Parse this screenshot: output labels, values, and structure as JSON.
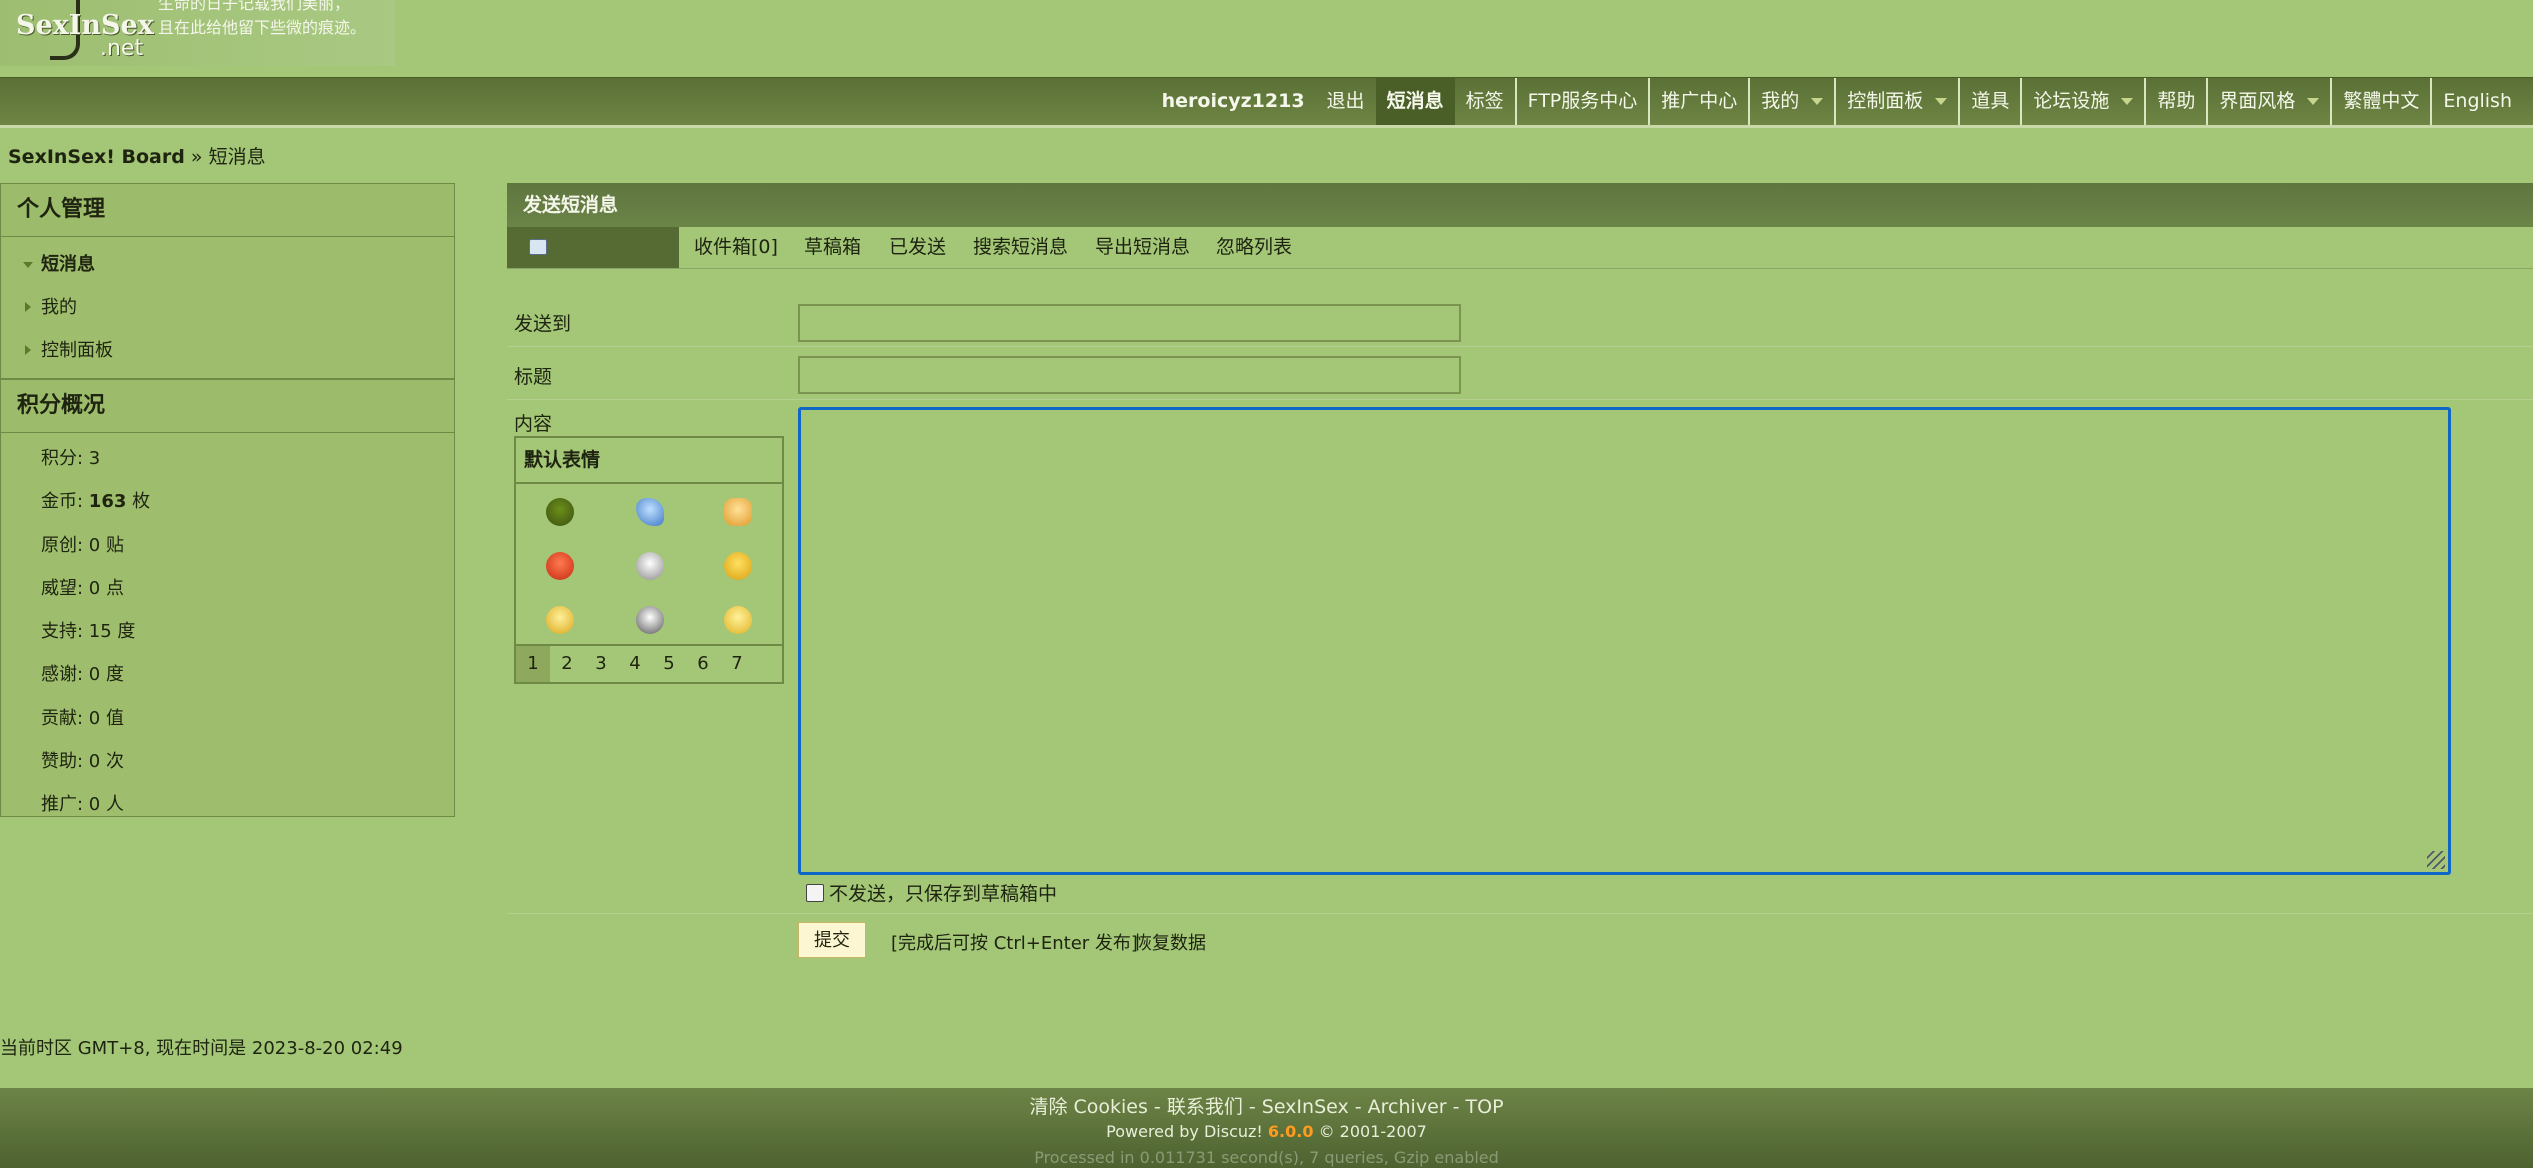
{
  "header": {
    "brand": "SexInSex",
    "brand_suffix": ".net",
    "slogan_line1": "生命的日子记载我们美丽，",
    "slogan_line2": "且在此给他留下些微的痕迹。"
  },
  "topnav": {
    "username": "heroicyz1213",
    "items": [
      "退出",
      "短消息",
      "标签",
      "FTP服务中心",
      "推广中心",
      "我的",
      "控制面板",
      "道具",
      "论坛设施",
      "帮助",
      "界面风格",
      "繁體中文",
      "English"
    ]
  },
  "breadcrumb": {
    "home": "SexInSex! Board",
    "sep": "»",
    "current": "短消息"
  },
  "sidebar": {
    "title": "个人管理",
    "menu": [
      "短消息",
      "我的",
      "控制面板"
    ],
    "stats_title": "积分概况",
    "stats": [
      {
        "label": "积分: 3"
      },
      {
        "label": "金币: ",
        "bold": "163",
        "suffix": " 枚"
      },
      {
        "label": "原创: 0 贴"
      },
      {
        "label": "威望: 0 点"
      },
      {
        "label": "支持: 15 度"
      },
      {
        "label": "感谢: 0 度"
      },
      {
        "label": "贡献: 0 值"
      },
      {
        "label": "赞助: 0 次"
      },
      {
        "label": "推广: 0 人"
      }
    ]
  },
  "main": {
    "title": "发送短消息",
    "tabs": [
      "收件箱[0]",
      "草稿箱",
      "已发送",
      "搜索短消息",
      "导出短消息",
      "忽略列表"
    ],
    "send_to_label": "发送到",
    "subject_label": "标题",
    "content_label": "内容",
    "smilies_title": "默认表情",
    "smilies_pages": [
      "1",
      "2",
      "3",
      "4",
      "5",
      "6",
      "7"
    ],
    "save_draft_label": "不发送，只保存到草稿箱中",
    "submit_label": "提交",
    "hint": "[完成后可按 Ctrl+Enter 发布]",
    "restore": "恢复数据"
  },
  "timezone": "当前时区 GMT+8, 现在时间是 2023-8-20 02:49",
  "footer": {
    "links": "清除 Cookies - 联系我们 - SexInSex - Archiver - TOP",
    "powered_prefix": "Powered by Discuz!",
    "version": "6.0.0",
    "copyright": "© 2001-2007",
    "processed": "Processed in 0.011731 second(s), 7 queries, Gzip enabled"
  },
  "colors": {
    "background": "#a3c677",
    "nav": "#5f7640",
    "accent": "#ff9b1e",
    "focus": "#1066c6"
  }
}
